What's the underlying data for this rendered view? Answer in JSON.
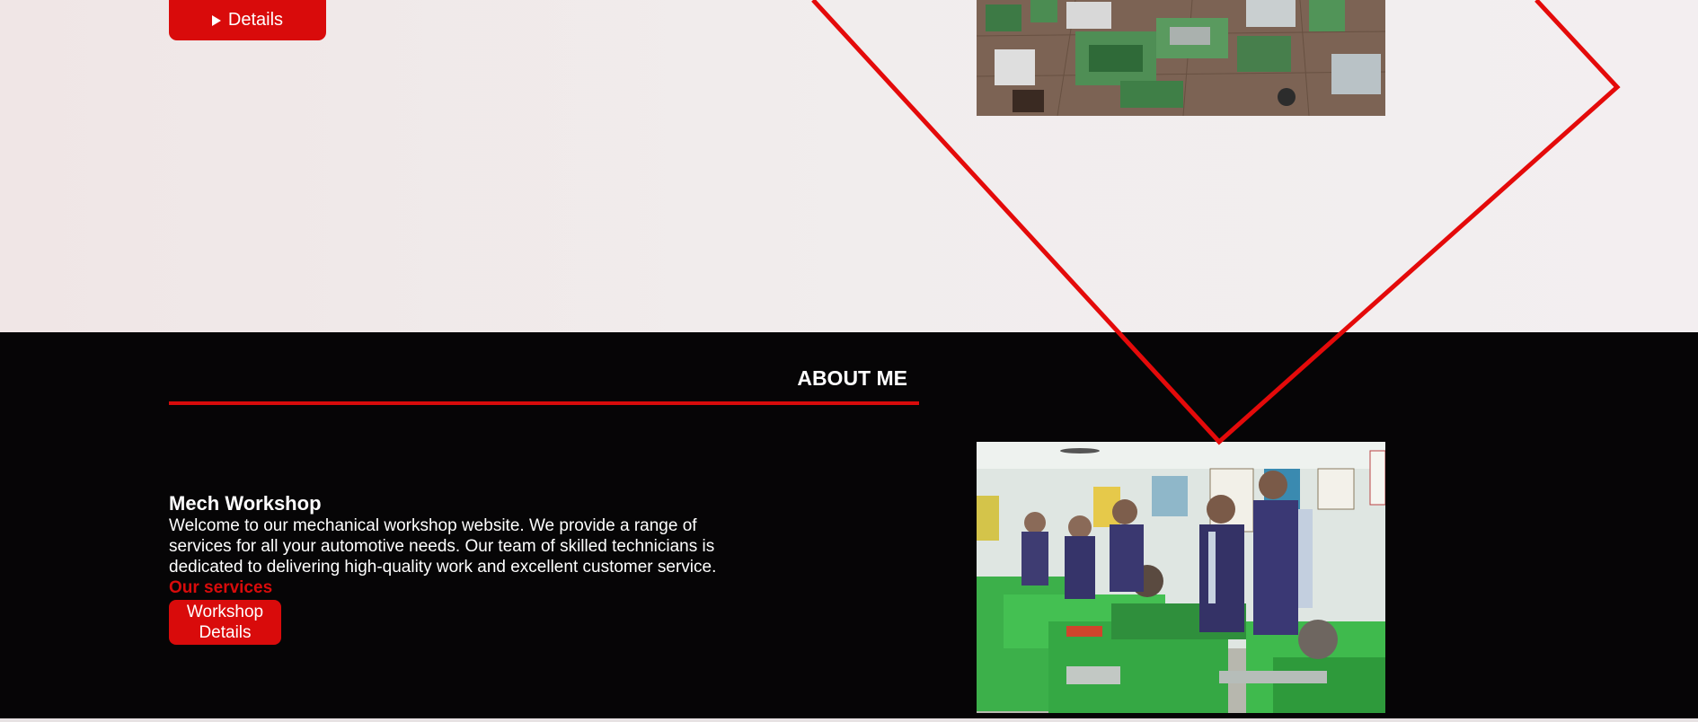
{
  "hero": {
    "details_label": "Details"
  },
  "about": {
    "section_title": "ABOUT ME",
    "heading": "Mech Workshop",
    "paragraph": "Welcome to our mechanical workshop website. We provide a range of services for all your automotive needs. Our team of skilled technicians is dedicated to delivering high-quality work and excellent customer service.",
    "services_label": "Our services",
    "workshop_button_label": "Workshop Details"
  },
  "colors": {
    "accent_red": "#d90b0b",
    "dark_bg": "#060506",
    "light_bg": "#f1eded"
  },
  "icons": {
    "details_button_icon": "play-icon"
  }
}
